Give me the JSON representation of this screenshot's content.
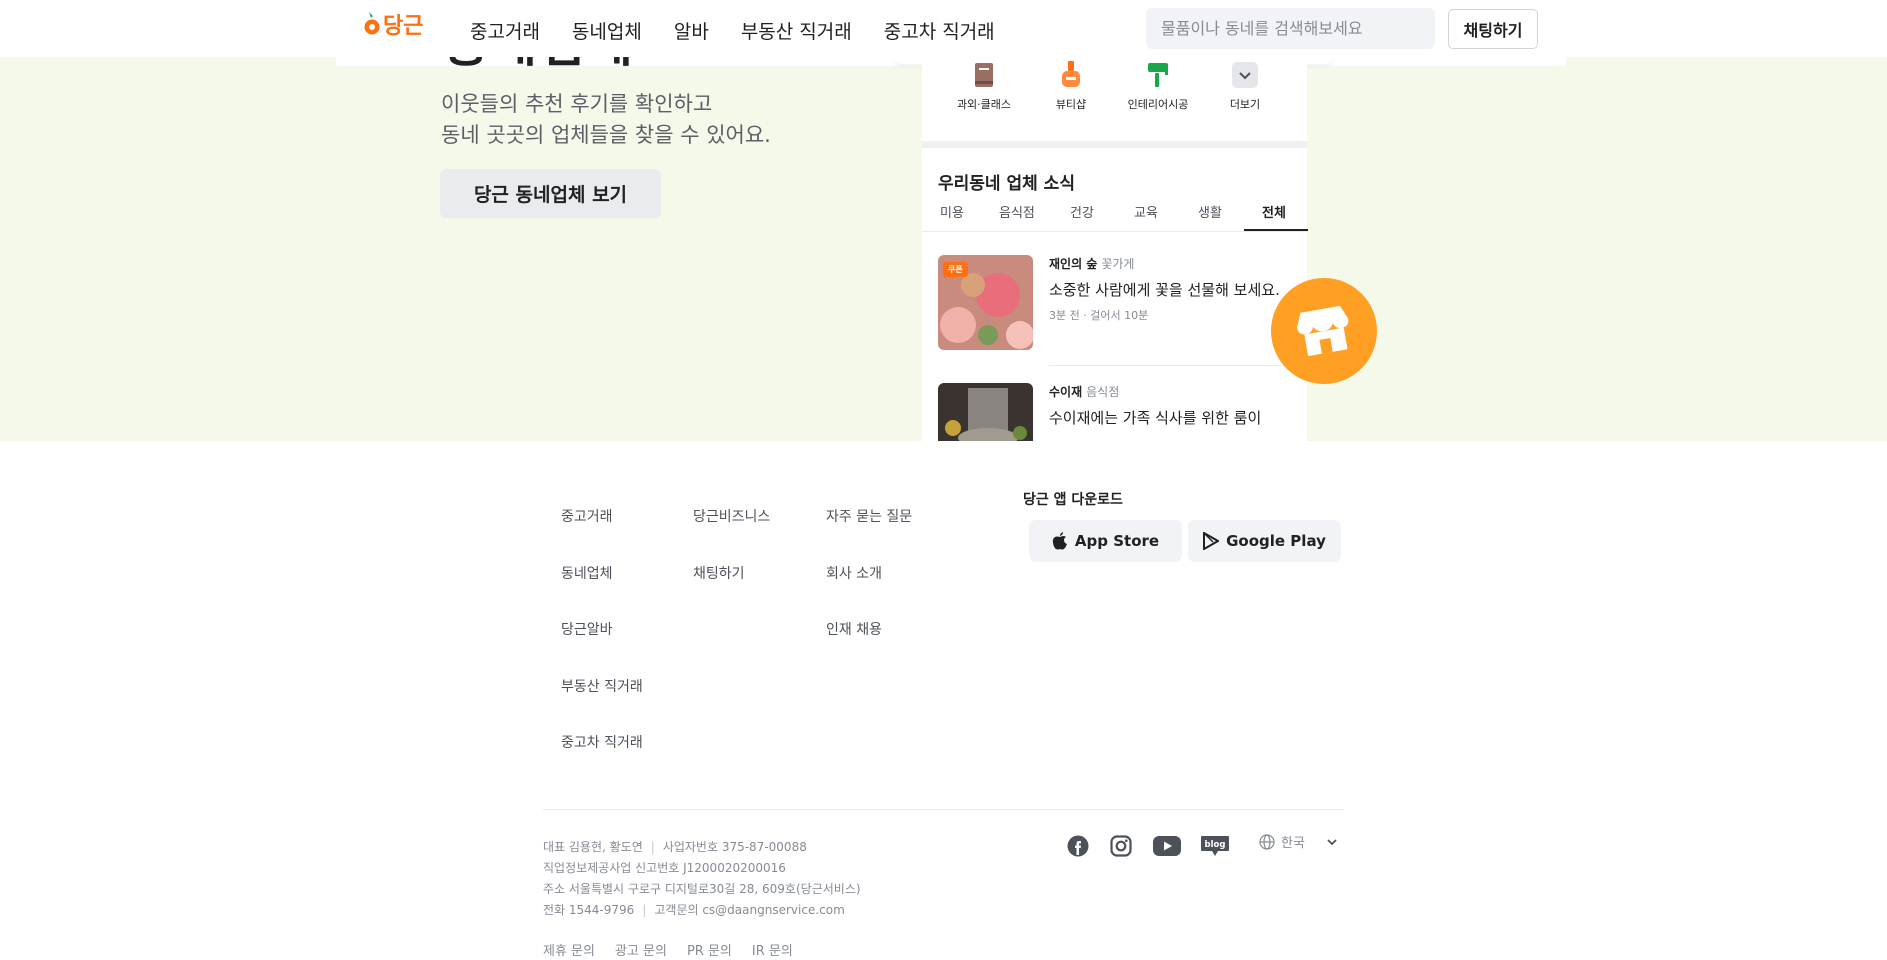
{
  "header": {
    "logo_text": "당근",
    "nav": [
      "중고거래",
      "동네업체",
      "알바",
      "부동산 직거래",
      "중고차 직거래"
    ],
    "search_placeholder": "물품이나 동네를 검색해보세요",
    "chat_button": "채팅하기"
  },
  "hero": {
    "title_partial": "동네업체",
    "subtitle_line1": "이웃들의 추천 후기를 확인하고",
    "subtitle_line2": "동네 곳곳의 업체들을 찾을 수 있어요.",
    "cta_button": "당근 동네업체 보기"
  },
  "phone": {
    "categories": [
      {
        "label": "과외·클래스",
        "icon": "book-icon"
      },
      {
        "label": "뷰티샵",
        "icon": "nail-polish-icon"
      },
      {
        "label": "인테리어시공",
        "icon": "paint-roller-icon"
      },
      {
        "label": "더보기",
        "icon": "chevron-down-icon"
      }
    ],
    "news_title": "우리동네 업체 소식",
    "tabs": [
      "미용",
      "음식점",
      "건강",
      "교육",
      "생활",
      "전체"
    ],
    "active_tab": "전체",
    "items": [
      {
        "badge": "쿠폰",
        "name": "재인의 숲",
        "category": "꽃가게",
        "desc": "소중한 사람에게 꽃을 선물해 보세요.",
        "meta": "3분 전 · 걸어서 10분"
      },
      {
        "badge": "",
        "name": "수이재",
        "category": "음식점",
        "desc": "수이재에는 가족 식사를 위한 룸이",
        "meta": ""
      }
    ]
  },
  "footer": {
    "col1": [
      "중고거래",
      "동네업체",
      "당근알바",
      "부동산 직거래",
      "중고차 직거래"
    ],
    "col2": [
      "당근비즈니스",
      "채팅하기"
    ],
    "col3": [
      "자주 묻는 질문",
      "회사 소개",
      "인재 채용"
    ],
    "app_download_title": "당근 앱 다운로드",
    "app_store": "App Store",
    "google_play": "Google Play",
    "company": {
      "ceo": "대표 김용현, 황도연",
      "biz_no": "사업자번호 375-87-00088",
      "job_info": "직업정보제공사업 신고번호 J1200020200016",
      "address": "주소 서울특별시 구로구 디지털로30길 28, 609호(당근서비스)",
      "phone": "전화 1544-9796",
      "cs": "고객문의 cs@daangnservice.com"
    },
    "policy": [
      "제휴 문의",
      "광고 문의",
      "PR 문의",
      "IR 문의"
    ],
    "language": "한국",
    "social": [
      "facebook-icon",
      "instagram-icon",
      "youtube-icon",
      "blog-icon"
    ]
  },
  "colors": {
    "brand": "#ff6f0f",
    "hero_bg": "#f4f9ea",
    "float_button": "#ff9f24"
  }
}
